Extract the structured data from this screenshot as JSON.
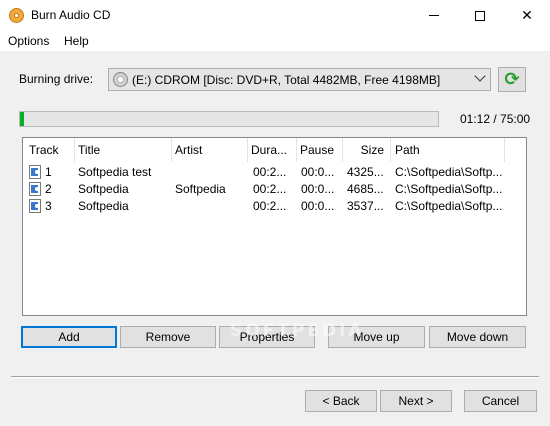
{
  "window": {
    "title": "Burn Audio CD",
    "close_glyph": "✕"
  },
  "menu": [
    "Options",
    "Help"
  ],
  "drive": {
    "label": "Burning drive:",
    "selected": "(E:) CDROM [Disc: DVD+R, Total 4482MB, Free 4198MB]",
    "refresh_icon": "refresh-icon",
    "refresh_glyph": "⟳"
  },
  "progress": {
    "fraction": 0.01,
    "time_text": "01:12 / 75:00",
    "color": "#06b025"
  },
  "tracks": {
    "columns": [
      "Track",
      "Title",
      "Artist",
      "Dura...",
      "Pause",
      "Size",
      "Path"
    ],
    "rows": [
      [
        "1",
        "Softpedia test",
        "",
        "00:2...",
        "00:0...",
        "4325...",
        "C:\\Softpedia\\Softp..."
      ],
      [
        "2",
        "Softpedia",
        "Softpedia",
        "00:2...",
        "00:0...",
        "4685...",
        "C:\\Softpedia\\Softp..."
      ],
      [
        "3",
        "Softpedia",
        "",
        "00:2...",
        "00:0...",
        "3537...",
        "C:\\Softpedia\\Softp..."
      ]
    ]
  },
  "actions": {
    "add": "Add",
    "remove": "Remove",
    "properties": "Properties",
    "move_up": "Move up",
    "move_down": "Move down"
  },
  "watermark": "SOFTPEDIA",
  "footer": {
    "back": "< Back",
    "next": "Next >",
    "cancel": "Cancel"
  }
}
